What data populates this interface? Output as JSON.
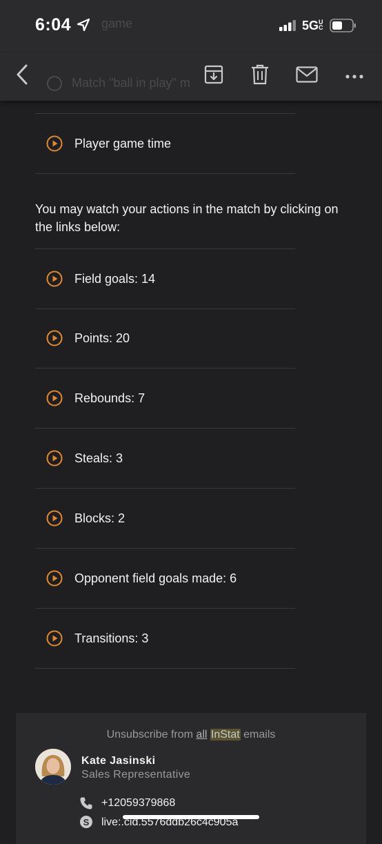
{
  "status": {
    "time": "6:04",
    "network": "5G",
    "network_sup": "UC",
    "behind_text": "game"
  },
  "toolbar": {
    "behind_text": "Match \"ball in play\" m",
    "icons": [
      "back-chevron-icon",
      "archive-icon",
      "trash-icon",
      "mail-icon",
      "more-icon"
    ]
  },
  "links_top": [
    {
      "label": "Player game time"
    }
  ],
  "intro_text": "You may watch your actions in the match by clicking on the links below:",
  "links": [
    {
      "label": "Field goals: 14"
    },
    {
      "label": "Points: 20"
    },
    {
      "label": "Rebounds: 7"
    },
    {
      "label": "Steals: 3"
    },
    {
      "label": "Blocks: 2"
    },
    {
      "label": "Opponent field goals made: 6"
    },
    {
      "label": "Transitions: 3"
    }
  ],
  "footer": {
    "unsub_pre": "Unsubscribe from",
    "unsub_all": "all",
    "unsub_brand": "InStat",
    "unsub_post": "emails",
    "name": "Kate Jasinski",
    "role": "Sales Representative",
    "phone": "+12059379868",
    "skype": "live:.cid.5576ddb26c4c905a"
  },
  "colors": {
    "accent": "#e08a2e",
    "background": "#1f1f21",
    "bar": "#2b2b2d"
  }
}
